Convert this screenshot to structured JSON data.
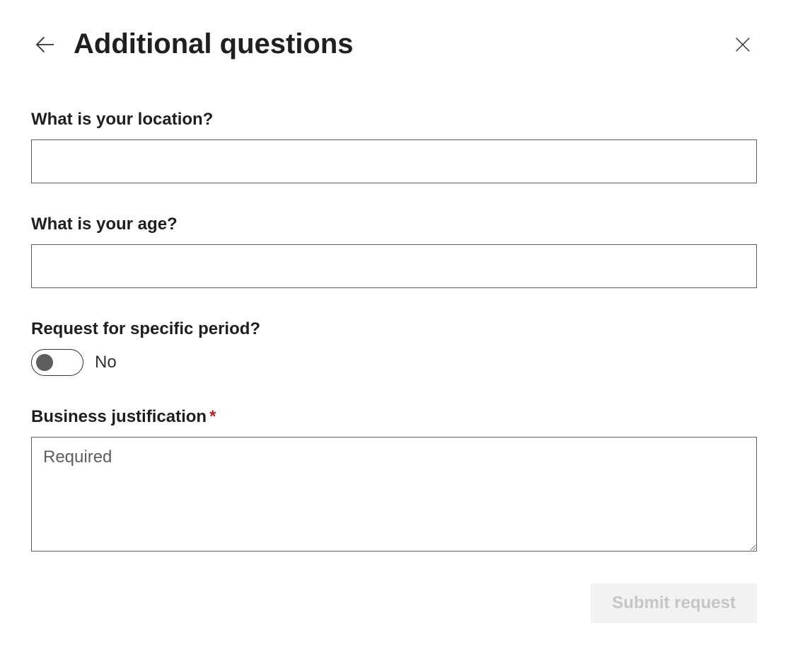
{
  "header": {
    "title": "Additional questions"
  },
  "fields": {
    "location": {
      "label": "What is your location?",
      "value": ""
    },
    "age": {
      "label": "What is your age?",
      "value": ""
    },
    "specific_period": {
      "label": "Request for specific period?",
      "toggle_value": "No"
    },
    "business_justification": {
      "label": "Business justification",
      "required_mark": "*",
      "placeholder": "Required",
      "value": ""
    }
  },
  "footer": {
    "submit_label": "Submit request"
  }
}
